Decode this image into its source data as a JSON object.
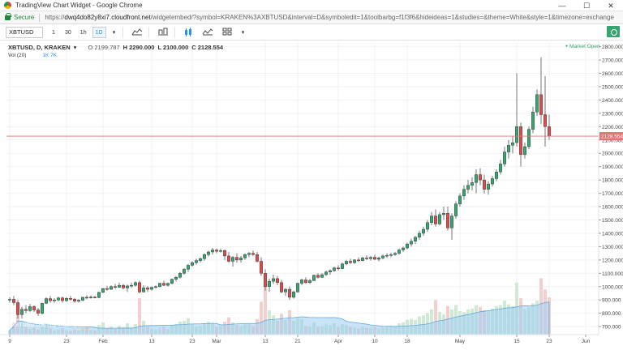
{
  "window": {
    "title": "TradingView Chart Widget - Google Chrome",
    "minimize": "—",
    "maximize": "☐",
    "close": "✕"
  },
  "address": {
    "secure_label": "Secure",
    "url_scheme": "https://",
    "url_host": "dwq4do82y8xi7.cloudfront.net",
    "url_path": "/widgetembed/?symbol=KRAKEN%3AXBTUSD&interval=D&symboledit=1&toolbarbg=f1f3f6&hideideas=1&studies=&theme=White&style=1&timezone=exchange"
  },
  "toolbar": {
    "symbol": "XBTUSD",
    "intervals": [
      "1",
      "30",
      "1h",
      "1D"
    ],
    "active_interval": "1D"
  },
  "legend": {
    "symbol": "XBTUSD, D, KRAKEN",
    "o": "O 2199.787",
    "h": "H 2290.000",
    "l": "L 2100.000",
    "c": "C 2128.554",
    "volume": "Vol (20)",
    "vol_values": "1K 7K",
    "market": "Market Open"
  },
  "watermark": "XBTUSD chart by TradingView",
  "colors": {
    "up": "#37a570",
    "down": "#dd4b4b",
    "vol_up": "#cfe9d4",
    "vol_down": "#f4cfcf",
    "vol_ma": "#9ccdf0",
    "last_line": "#e57373"
  },
  "chart_data": {
    "type": "candlestick",
    "price_axis_ticks": [
      700,
      800,
      900,
      1000,
      1100,
      1200,
      1300,
      1400,
      1500,
      1600,
      1700,
      1800,
      1900,
      2000,
      2100,
      2200,
      2300,
      2400,
      2500,
      2600,
      2700,
      2800
    ],
    "ylim": [
      640,
      2840
    ],
    "last_price": 2128.554,
    "time_axis_ticks": [
      {
        "label": "9",
        "i": 0
      },
      {
        "label": "23",
        "i": 14
      },
      {
        "label": "Feb",
        "i": 23
      },
      {
        "label": "13",
        "i": 35
      },
      {
        "label": "23",
        "i": 45
      },
      {
        "label": "Mar",
        "i": 51
      },
      {
        "label": "13",
        "i": 63
      },
      {
        "label": "21",
        "i": 71
      },
      {
        "label": "Apr",
        "i": 81
      },
      {
        "label": "10",
        "i": 90
      },
      {
        "label": "18",
        "i": 98
      },
      {
        "label": "May",
        "i": 111
      },
      {
        "label": "15",
        "i": 125
      },
      {
        "label": "23",
        "i": 133
      },
      {
        "label": "Jun",
        "i": 142
      }
    ],
    "candles": [
      [
        900,
        920,
        880,
        905
      ],
      [
        905,
        930,
        860,
        880
      ],
      [
        880,
        900,
        760,
        790
      ],
      [
        790,
        850,
        760,
        830
      ],
      [
        830,
        860,
        800,
        820
      ],
      [
        820,
        870,
        810,
        850
      ],
      [
        850,
        860,
        810,
        825
      ],
      [
        825,
        840,
        780,
        800
      ],
      [
        800,
        880,
        790,
        875
      ],
      [
        875,
        920,
        870,
        910
      ],
      [
        910,
        930,
        880,
        895
      ],
      [
        895,
        915,
        880,
        900
      ],
      [
        900,
        925,
        890,
        915
      ],
      [
        915,
        925,
        880,
        895
      ],
      [
        895,
        920,
        885,
        912
      ],
      [
        912,
        930,
        895,
        905
      ],
      [
        905,
        915,
        880,
        890
      ],
      [
        890,
        905,
        880,
        898
      ],
      [
        898,
        925,
        890,
        920
      ],
      [
        920,
        935,
        905,
        915
      ],
      [
        915,
        935,
        910,
        922
      ],
      [
        922,
        930,
        912,
        918
      ],
      [
        918,
        960,
        912,
        958
      ],
      [
        958,
        990,
        950,
        985
      ],
      [
        985,
        1005,
        970,
        980
      ],
      [
        980,
        1010,
        975,
        1000
      ],
      [
        1000,
        1020,
        985,
        995
      ],
      [
        995,
        1030,
        990,
        1010
      ],
      [
        1010,
        1020,
        980,
        990
      ],
      [
        990,
        1015,
        960,
        1005
      ],
      [
        1005,
        1030,
        990,
        1010
      ],
      [
        1010,
        1040,
        1000,
        1030
      ],
      [
        1030,
        1045,
        950,
        960
      ],
      [
        960,
        1010,
        955,
        990
      ],
      [
        990,
        1005,
        960,
        980
      ],
      [
        980,
        1000,
        970,
        995
      ],
      [
        995,
        1010,
        985,
        1000
      ],
      [
        1000,
        1030,
        995,
        1025
      ],
      [
        1025,
        1045,
        1005,
        1010
      ],
      [
        1010,
        1030,
        1000,
        1025
      ],
      [
        1025,
        1060,
        1015,
        1055
      ],
      [
        1055,
        1080,
        1040,
        1070
      ],
      [
        1070,
        1110,
        1060,
        1100
      ],
      [
        1100,
        1140,
        1090,
        1130
      ],
      [
        1130,
        1170,
        1110,
        1160
      ],
      [
        1160,
        1190,
        1150,
        1180
      ],
      [
        1180,
        1210,
        1165,
        1195
      ],
      [
        1195,
        1220,
        1180,
        1210
      ],
      [
        1210,
        1250,
        1195,
        1240
      ],
      [
        1240,
        1270,
        1225,
        1260
      ],
      [
        1260,
        1290,
        1240,
        1275
      ],
      [
        1275,
        1285,
        1250,
        1265
      ],
      [
        1265,
        1285,
        1255,
        1270
      ],
      [
        1270,
        1280,
        1200,
        1230
      ],
      [
        1230,
        1260,
        1180,
        1190
      ],
      [
        1190,
        1230,
        1150,
        1220
      ],
      [
        1220,
        1250,
        1180,
        1200
      ],
      [
        1200,
        1230,
        1180,
        1215
      ],
      [
        1215,
        1250,
        1200,
        1240
      ],
      [
        1240,
        1260,
        1220,
        1250
      ],
      [
        1250,
        1270,
        1230,
        1240
      ],
      [
        1240,
        1260,
        1180,
        1190
      ],
      [
        1190,
        1220,
        1080,
        1100
      ],
      [
        1100,
        1130,
        970,
        1000
      ],
      [
        1000,
        1060,
        960,
        1040
      ],
      [
        1040,
        1090,
        1020,
        1060
      ],
      [
        1060,
        1080,
        1010,
        1030
      ],
      [
        1030,
        1050,
        950,
        960
      ],
      [
        960,
        990,
        930,
        980
      ],
      [
        980,
        1000,
        900,
        920
      ],
      [
        920,
        970,
        910,
        960
      ],
      [
        960,
        1030,
        955,
        1025
      ],
      [
        1025,
        1060,
        1010,
        1050
      ],
      [
        1050,
        1070,
        1020,
        1030
      ],
      [
        1030,
        1060,
        1020,
        1045
      ],
      [
        1045,
        1090,
        1040,
        1085
      ],
      [
        1085,
        1100,
        1060,
        1070
      ],
      [
        1070,
        1100,
        1065,
        1090
      ],
      [
        1090,
        1120,
        1080,
        1110
      ],
      [
        1110,
        1130,
        1090,
        1120
      ],
      [
        1120,
        1150,
        1110,
        1140
      ],
      [
        1140,
        1160,
        1120,
        1135
      ],
      [
        1135,
        1180,
        1130,
        1170
      ],
      [
        1170,
        1200,
        1160,
        1190
      ],
      [
        1190,
        1210,
        1170,
        1180
      ],
      [
        1180,
        1205,
        1170,
        1200
      ],
      [
        1200,
        1220,
        1185,
        1195
      ],
      [
        1195,
        1225,
        1190,
        1215
      ],
      [
        1215,
        1235,
        1200,
        1210
      ],
      [
        1210,
        1230,
        1195,
        1220
      ],
      [
        1220,
        1240,
        1200,
        1205
      ],
      [
        1205,
        1225,
        1190,
        1215
      ],
      [
        1215,
        1240,
        1205,
        1230
      ],
      [
        1230,
        1250,
        1215,
        1235
      ],
      [
        1235,
        1255,
        1220,
        1240
      ],
      [
        1240,
        1260,
        1230,
        1250
      ],
      [
        1250,
        1285,
        1240,
        1275
      ],
      [
        1275,
        1300,
        1260,
        1290
      ],
      [
        1290,
        1330,
        1280,
        1320
      ],
      [
        1320,
        1360,
        1300,
        1340
      ],
      [
        1340,
        1380,
        1320,
        1370
      ],
      [
        1370,
        1420,
        1350,
        1400
      ],
      [
        1400,
        1450,
        1380,
        1430
      ],
      [
        1430,
        1500,
        1410,
        1480
      ],
      [
        1480,
        1560,
        1460,
        1530
      ],
      [
        1530,
        1580,
        1450,
        1470
      ],
      [
        1470,
        1560,
        1460,
        1540
      ],
      [
        1540,
        1600,
        1500,
        1550
      ],
      [
        1550,
        1600,
        1420,
        1440
      ],
      [
        1440,
        1550,
        1350,
        1530
      ],
      [
        1530,
        1640,
        1510,
        1620
      ],
      [
        1620,
        1700,
        1600,
        1680
      ],
      [
        1680,
        1760,
        1650,
        1730
      ],
      [
        1730,
        1800,
        1700,
        1760
      ],
      [
        1760,
        1820,
        1720,
        1780
      ],
      [
        1780,
        1880,
        1700,
        1840
      ],
      [
        1840,
        1890,
        1760,
        1800
      ],
      [
        1800,
        1840,
        1700,
        1730
      ],
      [
        1730,
        1790,
        1690,
        1770
      ],
      [
        1770,
        1830,
        1750,
        1810
      ],
      [
        1810,
        1880,
        1790,
        1860
      ],
      [
        1860,
        1950,
        1840,
        1920
      ],
      [
        1920,
        2050,
        1900,
        2010
      ],
      [
        2010,
        2100,
        1960,
        2060
      ],
      [
        2060,
        2130,
        2000,
        2080
      ],
      [
        2080,
        2600,
        2050,
        2200
      ],
      [
        2200,
        2230,
        1900,
        1990
      ],
      [
        1990,
        2080,
        1960,
        2050
      ],
      [
        2050,
        2200,
        2030,
        2180
      ],
      [
        2180,
        2350,
        2150,
        2310
      ],
      [
        2310,
        2480,
        2280,
        2440
      ],
      [
        2440,
        2720,
        2220,
        2290
      ],
      [
        2290,
        2580,
        2050,
        2200
      ],
      [
        2200,
        2290,
        2100,
        2128.554
      ]
    ],
    "volume_scale_max": 7000,
    "volume": [
      500,
      1400,
      2800,
      1500,
      900,
      700,
      800,
      600,
      900,
      1300,
      700,
      500,
      600,
      700,
      500,
      450,
      600,
      500,
      700,
      900,
      550,
      500,
      1100,
      1400,
      700,
      900,
      650,
      1000,
      800,
      1300,
      700,
      1200,
      4200,
      1600,
      900,
      700,
      600,
      800,
      900,
      700,
      1100,
      1200,
      1500,
      1600,
      1900,
      1200,
      900,
      1000,
      1300,
      1500,
      1200,
      900,
      1000,
      1500,
      2000,
      1400,
      1100,
      1000,
      1200,
      1200,
      1000,
      1800,
      3800,
      6200,
      2800,
      2200,
      1600,
      2400,
      1700,
      2800,
      1600,
      1900,
      1800,
      1000,
      900,
      1400,
      900,
      1000,
      1200,
      1100,
      1300,
      900,
      1200,
      1100,
      900,
      800,
      700,
      900,
      800,
      800,
      900,
      700,
      800,
      900,
      1000,
      900,
      1300,
      1400,
      1700,
      1800,
      1700,
      2100,
      2200,
      2500,
      2900,
      4000,
      2600,
      2300,
      3300,
      2900,
      3400,
      2700,
      2600,
      2900,
      3000,
      3400,
      3200,
      2800,
      2700,
      3000,
      3300,
      3400,
      3900,
      3500,
      3300,
      6000,
      4200,
      2900,
      3200,
      3600,
      3900,
      6500,
      5200,
      4300
    ]
  }
}
